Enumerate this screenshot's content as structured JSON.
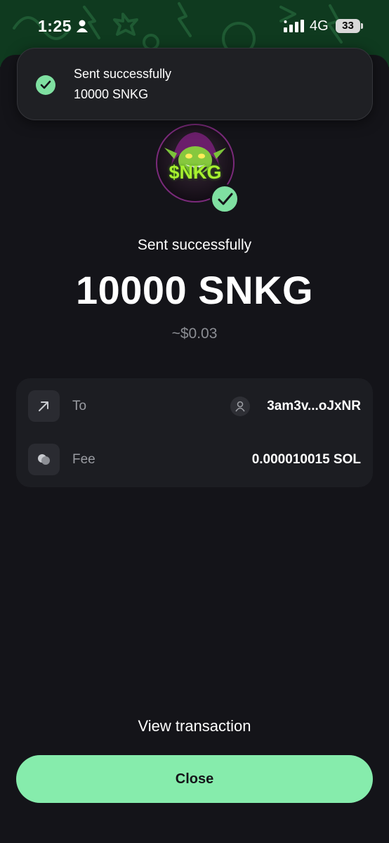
{
  "status_bar": {
    "time": "1:25",
    "network": "4G",
    "battery": "33"
  },
  "toast": {
    "title": "Sent successfully",
    "amount": "10000 SNKG"
  },
  "token": {
    "logo_text": "$NKG"
  },
  "result": {
    "title": "Sent successfully",
    "amount": "10000 SNKG",
    "usd_value": "~$0.03"
  },
  "details": {
    "to_label": "To",
    "to_value": "3am3v...oJxNR",
    "fee_label": "Fee",
    "fee_value": "0.000010015 SOL"
  },
  "actions": {
    "view_transaction": "View transaction",
    "close": "Close"
  },
  "colors": {
    "accent": "#86ecac",
    "background": "#141419",
    "card": "#1c1d22"
  }
}
